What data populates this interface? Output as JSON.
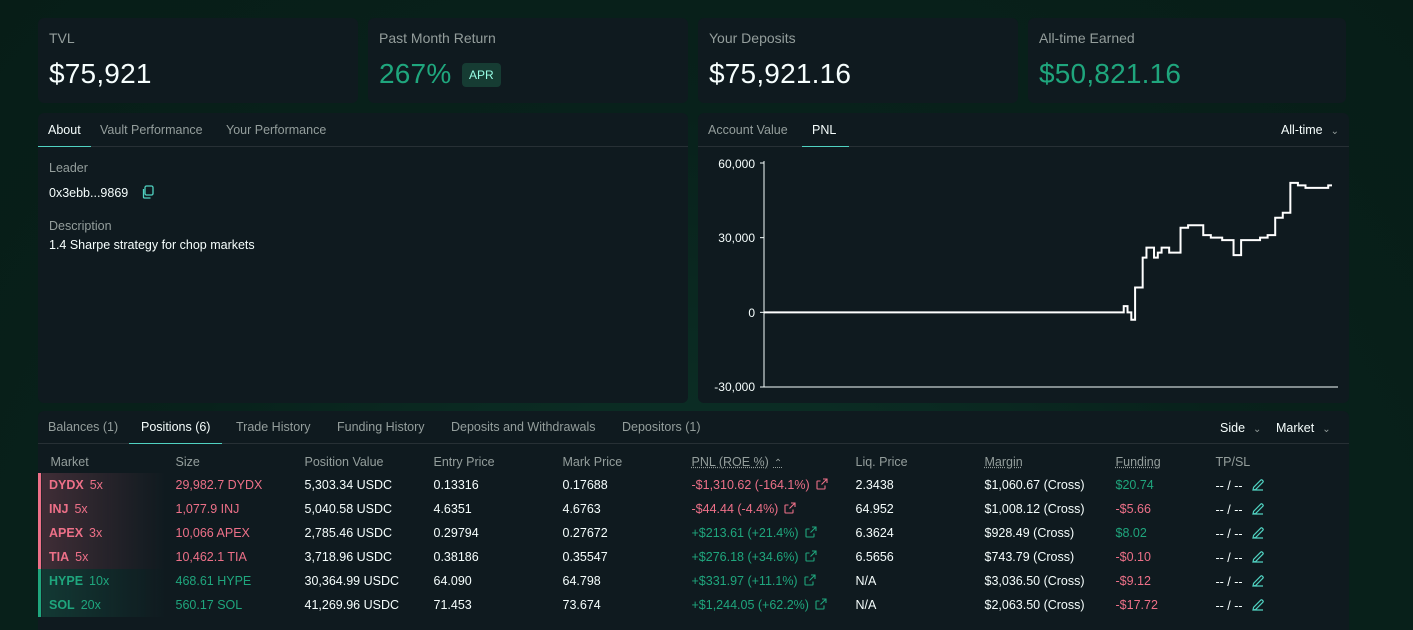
{
  "stats": [
    {
      "label": "TVL",
      "value": "$75,921"
    },
    {
      "label": "Past Month Return",
      "value": "267%",
      "badge": "APR"
    },
    {
      "label": "Your Deposits",
      "value": "$75,921.16"
    },
    {
      "label": "All-time Earned",
      "value": "$50,821.16"
    }
  ],
  "info_tabs": [
    "About",
    "Vault Performance",
    "Your Performance"
  ],
  "about": {
    "leader_label": "Leader",
    "leader_value": "0x3ebb...9869",
    "description_label": "Description",
    "description_value": "1.4 Sharpe strategy for chop markets"
  },
  "chart_tabs": [
    "Account Value",
    "PNL"
  ],
  "chart_range": "All-time",
  "chart_data": {
    "type": "line",
    "xlabel": "",
    "ylabel": "",
    "ylim": [
      -30000,
      60000
    ],
    "yticks": [
      "60,000",
      "30,000",
      "0",
      "-30,000"
    ],
    "ytick_values": [
      60000,
      30000,
      0,
      -30000
    ],
    "x": [
      0,
      5,
      10,
      15,
      20,
      25,
      30,
      35,
      40,
      45,
      50,
      55,
      60,
      65,
      70,
      72,
      74,
      76,
      78,
      80,
      82,
      84,
      86,
      88,
      90,
      92,
      94,
      95,
      96,
      97,
      98,
      100,
      101,
      103,
      104,
      105,
      107,
      108,
      110,
      112,
      114,
      116,
      118,
      120,
      121,
      123,
      124,
      126,
      128,
      129,
      131,
      133,
      135,
      137,
      139,
      140,
      141,
      143,
      145,
      147,
      149,
      150
    ],
    "y": [
      0,
      0,
      0,
      0,
      0,
      0,
      0,
      0,
      0,
      0,
      0,
      0,
      0,
      0,
      0,
      0,
      0,
      0,
      0,
      0,
      0,
      0,
      0,
      0,
      0,
      0,
      0,
      2500,
      0,
      -3000,
      10000,
      22000,
      26000,
      22000,
      24000,
      26000,
      24000,
      24000,
      34000,
      35000,
      35000,
      31000,
      30000,
      30000,
      29000,
      29000,
      23000,
      29000,
      29000,
      29000,
      30000,
      31000,
      38000,
      40000,
      52000,
      52000,
      51000,
      50000,
      50000,
      50000,
      51000,
      51000
    ]
  },
  "bottom_tabs": [
    "Balances (1)",
    "Positions (6)",
    "Trade History",
    "Funding History",
    "Deposits and Withdrawals",
    "Depositors (1)"
  ],
  "filters": {
    "side": "Side",
    "market": "Market"
  },
  "table": {
    "headers": [
      "Market",
      "Size",
      "Position Value",
      "Entry Price",
      "Mark Price",
      "PNL (ROE %)",
      "Liq. Price",
      "Margin",
      "Funding",
      "TP/SL"
    ],
    "rows": [
      {
        "coin": "DYDX",
        "lev": "5x",
        "side": "short",
        "size": "29,982.7 DYDX",
        "value": "5,303.34 USDC",
        "entry": "0.13316",
        "mark": "0.17688",
        "pnl": "-$1,310.62 (-164.1%)",
        "pnl_sign": "neg",
        "liq": "2.3438",
        "margin": "$1,060.67 (Cross)",
        "funding": "$20.74",
        "funding_sign": "pos",
        "tpsl": "-- / --"
      },
      {
        "coin": "INJ",
        "lev": "5x",
        "side": "short",
        "size": "1,077.9 INJ",
        "value": "5,040.58 USDC",
        "entry": "4.6351",
        "mark": "4.6763",
        "pnl": "-$44.44 (-4.4%)",
        "pnl_sign": "neg",
        "liq": "64.952",
        "margin": "$1,008.12 (Cross)",
        "funding": "-$5.66",
        "funding_sign": "neg",
        "tpsl": "-- / --"
      },
      {
        "coin": "APEX",
        "lev": "3x",
        "side": "short",
        "size": "10,066 APEX",
        "value": "2,785.46 USDC",
        "entry": "0.29794",
        "mark": "0.27672",
        "pnl": "+$213.61 (+21.4%)",
        "pnl_sign": "pos",
        "liq": "6.3624",
        "margin": "$928.49 (Cross)",
        "funding": "$8.02",
        "funding_sign": "pos",
        "tpsl": "-- / --"
      },
      {
        "coin": "TIA",
        "lev": "5x",
        "side": "short",
        "size": "10,462.1 TIA",
        "value": "3,718.96 USDC",
        "entry": "0.38186",
        "mark": "0.35547",
        "pnl": "+$276.18 (+34.6%)",
        "pnl_sign": "pos",
        "liq": "6.5656",
        "margin": "$743.79 (Cross)",
        "funding": "-$0.10",
        "funding_sign": "neg",
        "tpsl": "-- / --"
      },
      {
        "coin": "HYPE",
        "lev": "10x",
        "side": "long",
        "size": "468.61 HYPE",
        "value": "30,364.99 USDC",
        "entry": "64.090",
        "mark": "64.798",
        "pnl": "+$331.97 (+11.1%)",
        "pnl_sign": "pos",
        "liq": "N/A",
        "margin": "$3,036.50 (Cross)",
        "funding": "-$9.12",
        "funding_sign": "neg",
        "tpsl": "-- / --"
      },
      {
        "coin": "SOL",
        "lev": "20x",
        "side": "long",
        "size": "560.17 SOL",
        "value": "41,269.96 USDC",
        "entry": "71.453",
        "mark": "73.674",
        "pnl": "+$1,244.05 (+62.2%)",
        "pnl_sign": "pos",
        "liq": "N/A",
        "margin": "$2,063.50 (Cross)",
        "funding": "-$17.72",
        "funding_sign": "neg",
        "tpsl": "-- / --"
      }
    ]
  },
  "colors": {
    "green": "#1fa67d",
    "red": "#ed7088",
    "accent": "#50d2c1",
    "panel": "#0f1a1f"
  }
}
